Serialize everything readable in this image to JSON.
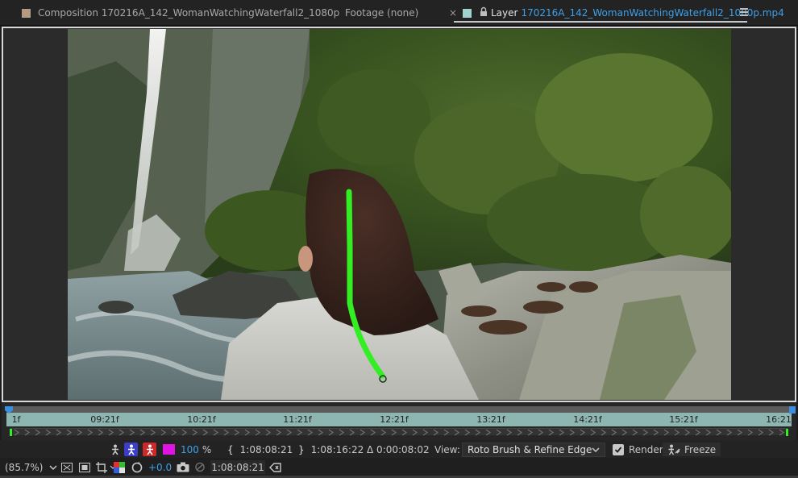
{
  "tabs": {
    "composition": {
      "label": "Composition 170216A_142_WomanWatchingWaterfall2_1080p",
      "swatch_color": "#b29a83"
    },
    "footage": {
      "label": "Footage (none)"
    },
    "close_glyph": "×",
    "layer": {
      "label": "Layer",
      "filename": "170216A_142_WomanWatchingWaterfall2_1080p.mp4",
      "swatch_color": "#9fd3cf"
    }
  },
  "timeline": {
    "start_label": "1f",
    "ticks": [
      "09:21f",
      "10:21f",
      "11:21f",
      "12:21f",
      "13:21f",
      "14:21f",
      "15:21f",
      "16:21"
    ],
    "ruler_color": "#8db6b2"
  },
  "roto_bar": {
    "opacity_value": "100",
    "opacity_unit": "%",
    "in_point": "1:08:08:21",
    "out_point": "1:08:16:22",
    "duration": "Δ 0:00:08:02",
    "view_label": "View:",
    "view_value": "Roto Brush & Refine Edge",
    "render_label": "Render",
    "freeze_label": "Freeze",
    "magenta_color": "#e014e0"
  },
  "bottom_bar": {
    "zoom": "(85.7%)",
    "exposure": "+0.0",
    "timecode": "1:08:08:21"
  },
  "stroke_color": "#33ee22"
}
